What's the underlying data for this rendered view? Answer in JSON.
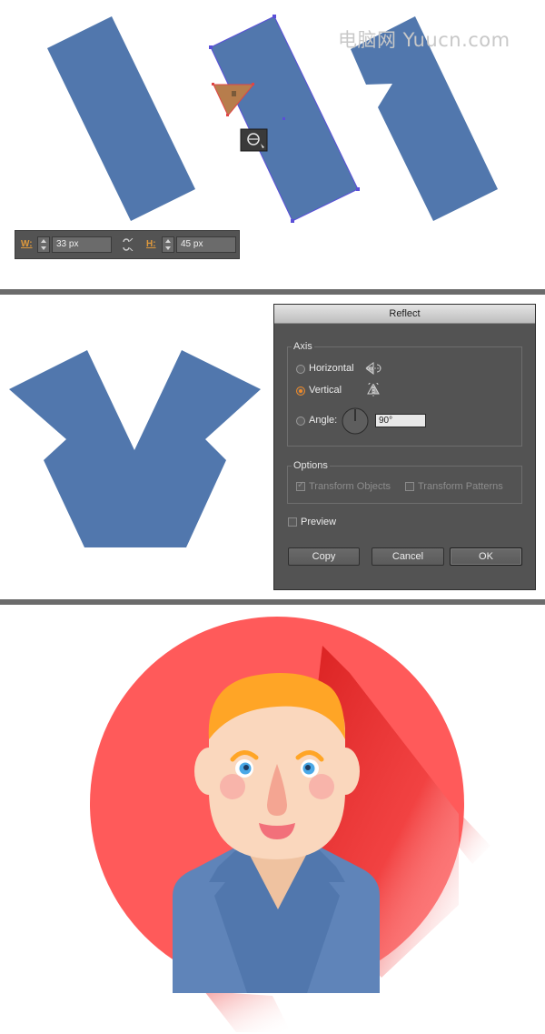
{
  "watermark": {
    "text": "电脑网 Yuucn.com"
  },
  "transform_toolbar": {
    "width_label": "W:",
    "width_value": "33 px",
    "height_label": "H:",
    "height_value": "45 px"
  },
  "reflect_dialog": {
    "title": "Reflect",
    "axis_group_label": "Axis",
    "horizontal_label": "Horizontal",
    "vertical_label": "Vertical",
    "angle_label": "Angle:",
    "angle_value": "90°",
    "selected_axis": "Vertical",
    "options_group_label": "Options",
    "transform_objects_label": "Transform Objects",
    "transform_patterns_label": "Transform Patterns",
    "preview_label": "Preview",
    "copy_label": "Copy",
    "cancel_label": "Cancel",
    "ok_label": "OK"
  },
  "colors": {
    "shape_blue": "#5177ad",
    "selection_purple": "#5a4fd8",
    "triangle_orange": "#b77d4c",
    "circle_red": "#ff5a5a",
    "hair_orange": "#ffa526",
    "skin": "#fad7bd",
    "shirt_blue": "#5f84b9"
  },
  "icons": {
    "lock": "link-constrain-icon",
    "cursor": "reflect-cursor-icon",
    "horizontal": "reflect-horizontal-icon",
    "vertical": "reflect-vertical-icon"
  }
}
